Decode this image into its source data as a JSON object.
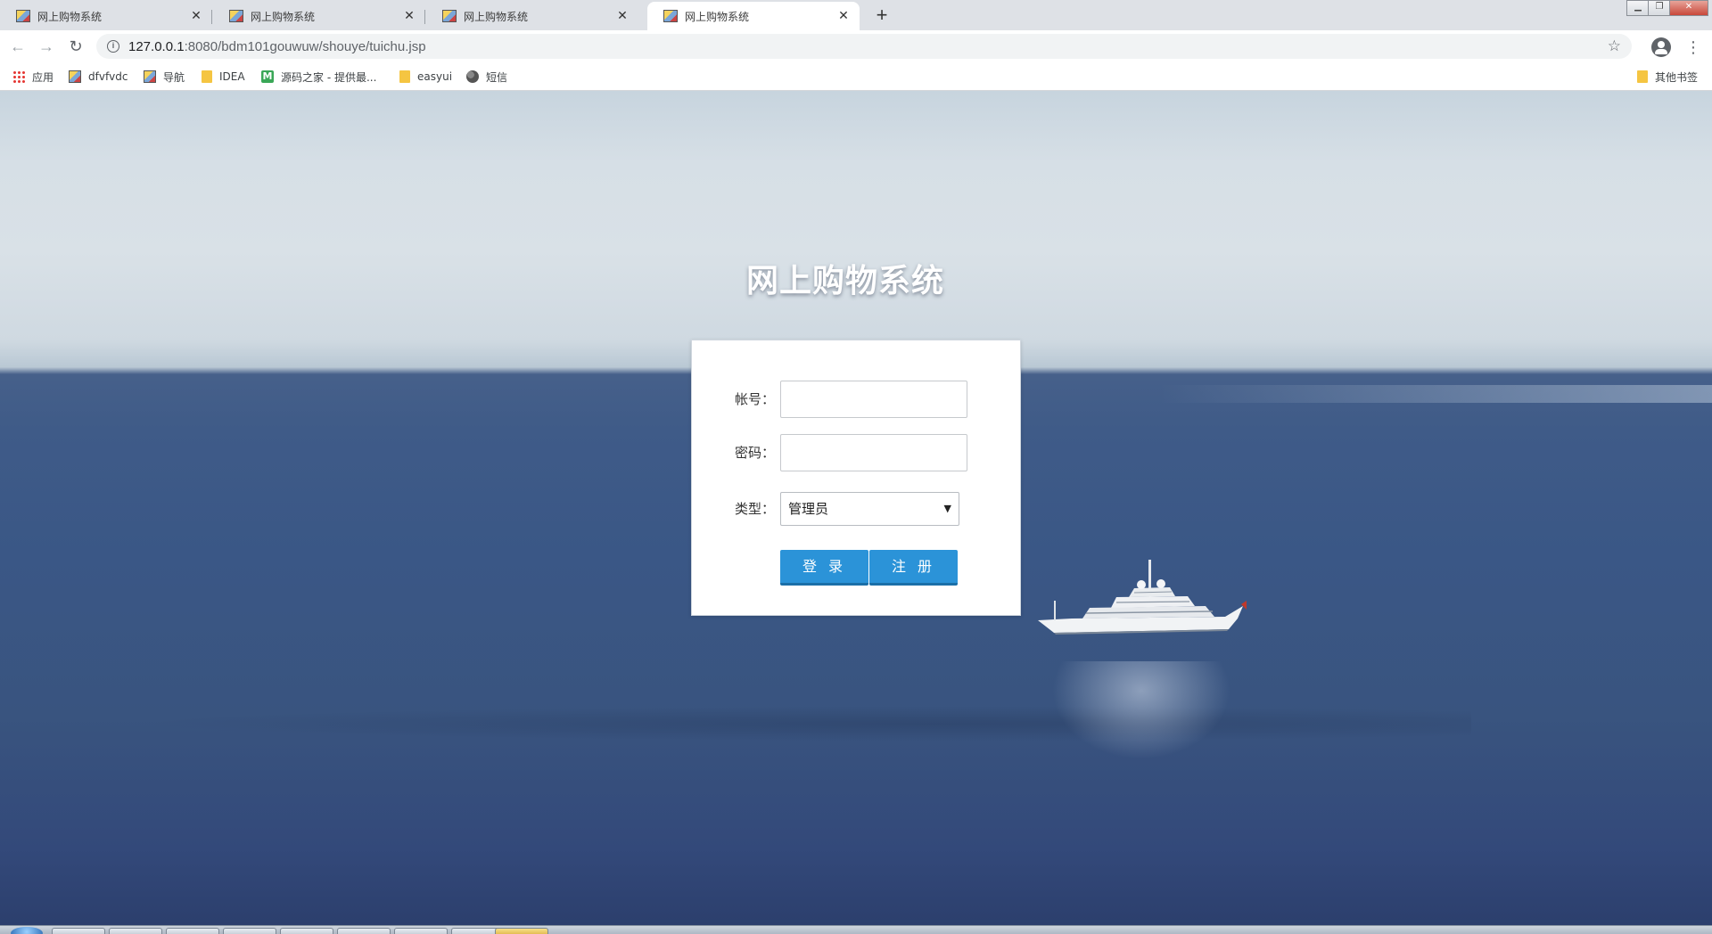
{
  "browser": {
    "tabs": [
      {
        "title": "网上购物系统",
        "active": false
      },
      {
        "title": "网上购物系统",
        "active": false
      },
      {
        "title": "网上购物系统",
        "active": false
      },
      {
        "title": "网上购物系统",
        "active": true
      }
    ],
    "new_tab_label": "+",
    "url_host": "127.0.0.1",
    "url_rest": ":8080/bdm101gouwuw/shouye/tuichu.jsp",
    "bookmarks": [
      {
        "label": "应用",
        "icon": "apps-grid-icon"
      },
      {
        "label": "dfvfvdc",
        "icon": "image-page-icon"
      },
      {
        "label": "导航",
        "icon": "image-page-icon"
      },
      {
        "label": "IDEA",
        "icon": "folder-icon"
      },
      {
        "label": "源码之家 - 提供最...",
        "icon": "m-site-icon"
      },
      {
        "label": "easyui",
        "icon": "folder-icon"
      },
      {
        "label": "短信",
        "icon": "globe-icon"
      }
    ],
    "other_bookmarks": "其他书签"
  },
  "page": {
    "title": "网上购物系统",
    "form": {
      "account_label": "帐号：",
      "account_value": "",
      "password_label": "密码：",
      "password_value": "",
      "type_label": "类型：",
      "type_selected": "管理员",
      "login_button": "登 录",
      "register_button": "注 册"
    }
  },
  "colors": {
    "button_blue": "#2b93d8",
    "sea_blue": "#3a5786",
    "sky": "#d6dfe6"
  }
}
